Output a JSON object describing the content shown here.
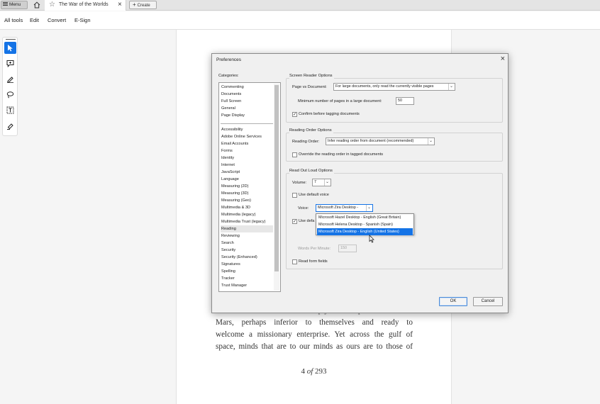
{
  "tabbar": {
    "menu_label": "Menu",
    "doc_tab_title": "The War of the Worlds",
    "create_label": "Create"
  },
  "menubar": {
    "items": [
      "All tools",
      "Edit",
      "Convert",
      "E-Sign"
    ]
  },
  "toolbar": {
    "tools": [
      "select-arrow-icon",
      "comment-icon",
      "draw-pen-icon",
      "lasso-icon",
      "text-box-icon",
      "highlight-pen-icon"
    ]
  },
  "page": {
    "lines": [
      "creatures that swarm and multiply in a drop of water. With",
      "Mars, perhaps inferior to themselves and ready to",
      "welcome a missionary enterprise. Yet across the gulf of",
      "space, minds that are to our minds as ours are to those of"
    ],
    "page_number": "4",
    "page_of": "of",
    "page_total": "293"
  },
  "dialog": {
    "title": "Preferences",
    "categories_label": "Categories:",
    "categories_top": [
      "Commenting",
      "Documents",
      "Full Screen",
      "General",
      "Page Display"
    ],
    "categories": [
      "Accessibility",
      "Adobe Online Services",
      "Email Accounts",
      "Forms",
      "Identity",
      "Internet",
      "JavaScript",
      "Language",
      "Measuring (2D)",
      "Measuring (3D)",
      "Measuring (Geo)",
      "Multimedia & 3D",
      "Multimedia (legacy)",
      "Multimedia Trust (legacy)",
      "Reading",
      "Reviewing",
      "Search",
      "Security",
      "Security (Enhanced)",
      "Signatures",
      "Spelling",
      "Tracker",
      "Trust Manager"
    ],
    "selected_category": "Reading",
    "screen_reader": {
      "title": "Screen Reader Options",
      "page_vs_doc_label": "Page vs Document:",
      "page_vs_doc_value": "For large documents, only read the currently visible pages",
      "min_pages_label": "Minimum number of pages in a large document:",
      "min_pages_value": "50",
      "confirm_label": "Confirm before tagging documents",
      "confirm_checked": true
    },
    "reading_order": {
      "title": "Reading Order Options",
      "order_label": "Reading Order:",
      "order_value": "Infer reading order from document (recommended)",
      "override_label": "Override the reading order in tagged documents",
      "override_checked": false
    },
    "read_out_loud": {
      "title": "Read Out Loud Options",
      "volume_label": "Volume:",
      "volume_value": "7",
      "use_default_voice_label": "Use default voice",
      "use_default_voice_checked": false,
      "voice_label": "Voice:",
      "voice_value": "Microsoft Zira Desktop -",
      "use_default_label": "Use defa",
      "use_default_checked": true,
      "words_per_minute_label": "Words Per Minute:",
      "words_per_minute_value": "150",
      "read_form_fields_label": "Read form fields",
      "read_form_fields_checked": false
    },
    "voice_options": [
      "Microsoft Hazel Desktop - English (Great Britain)",
      "Microsoft Helena Desktop - Spanish (Spain)",
      "Microsoft Zira Desktop - English (United States)"
    ],
    "voice_selected_index": 2,
    "ok_label": "OK",
    "cancel_label": "Cancel"
  },
  "colors": {
    "accent": "#1473e6",
    "dialog_bg": "#f0f0f0"
  }
}
